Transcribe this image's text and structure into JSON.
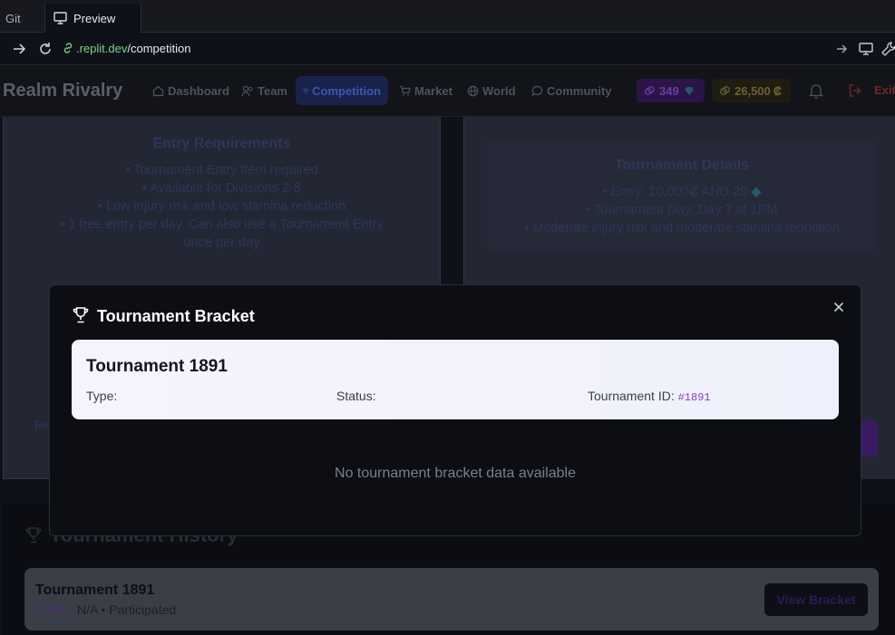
{
  "browser": {
    "tabs": [
      {
        "label": "Git"
      },
      {
        "label": "Preview"
      }
    ],
    "url_host": ".replit.dev",
    "url_path": "/competition"
  },
  "app": {
    "brand": "Realm Rivalry",
    "nav": [
      {
        "label": "Dashboard",
        "icon": "home-icon"
      },
      {
        "label": "Team",
        "icon": "users-icon"
      },
      {
        "label": "Competition",
        "icon": "trophy-icon",
        "active": true
      },
      {
        "label": "Market",
        "icon": "cart-icon"
      },
      {
        "label": "World",
        "icon": "globe-icon"
      },
      {
        "label": "Community",
        "icon": "chat-icon"
      }
    ],
    "gems": "349",
    "coins": "26,500",
    "coin_symbol": "₡",
    "exit_label": "Exit"
  },
  "background": {
    "left_card": {
      "title": "Entry Requirements",
      "lines": [
        "• Tournament Entry Item required",
        "• Available for Divisions 2-8",
        "• Low injury risk and low stamina reduction",
        "• 1 free entry per day. Can also use a Tournament Entry",
        "once per day"
      ],
      "fragment": "Re"
    },
    "right_card": {
      "title": "Tournament Details",
      "lines": [
        "• Entry: 10,000₡ AND 20",
        "• Tournament Day: Day 7 at 1PM",
        "• Moderate injury risk and moderate stamina reduction"
      ]
    },
    "history": {
      "title": "Tournament History",
      "item_title": "Tournament 1891",
      "item_id": "#1891",
      "item_meta": "N/A • Participated",
      "button": "View Bracket"
    }
  },
  "modal": {
    "title": "Tournament Bracket",
    "card_title": "Tournament 1891",
    "type_label": "Type:",
    "status_label": "Status:",
    "id_label": "Tournament ID:",
    "id_value": "#1891",
    "empty_message": "No tournament bracket data available"
  },
  "colors": {
    "accent_purple": "#8a3ec9",
    "active_nav": "#3c57b3",
    "modal_bg": "#0c0e13"
  }
}
